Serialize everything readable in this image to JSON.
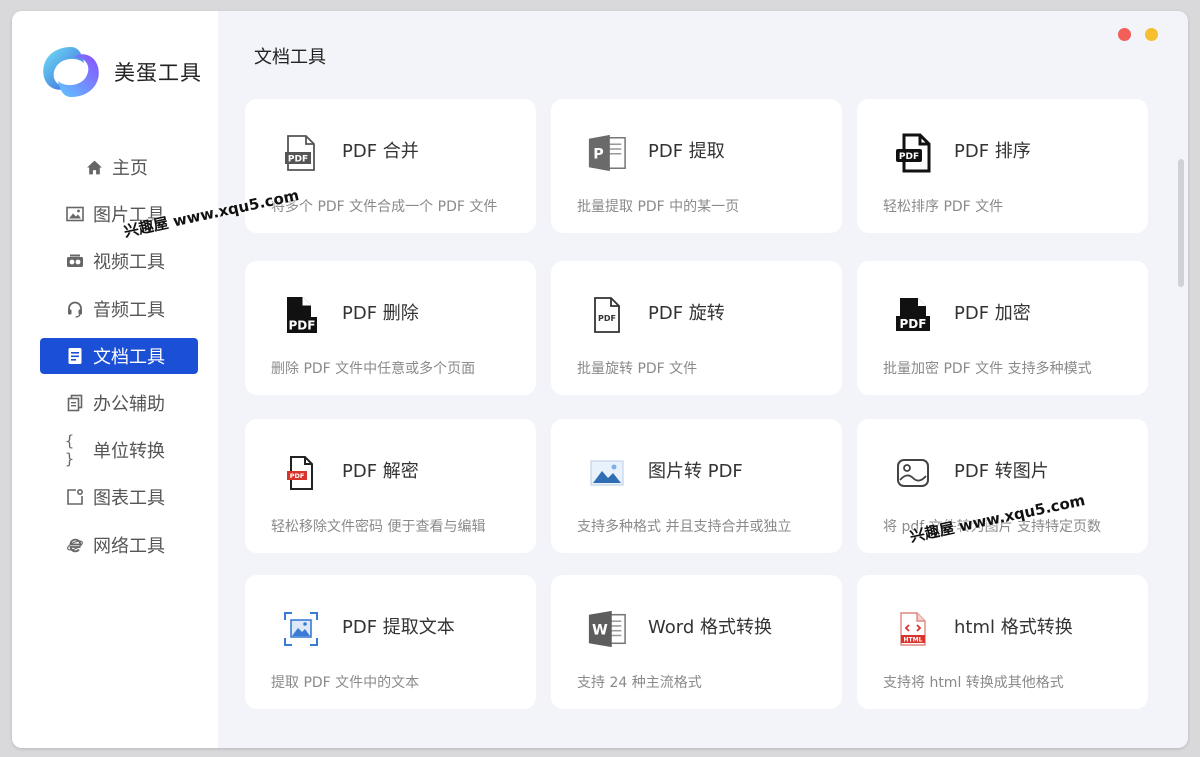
{
  "app": {
    "title": "美蛋工具"
  },
  "colors": {
    "accent": "#1b4fd6",
    "close": "#f25f58",
    "minimize": "#f6bf30",
    "pdf_red": "#d9342b"
  },
  "sidebar": {
    "items": [
      {
        "label": "主页",
        "icon": "home-icon",
        "active": false
      },
      {
        "label": "图片工具",
        "icon": "image-icon",
        "active": false
      },
      {
        "label": "视频工具",
        "icon": "video-icon",
        "active": false
      },
      {
        "label": "音频工具",
        "icon": "headset-icon",
        "active": false
      },
      {
        "label": "文档工具",
        "icon": "document-icon",
        "active": true
      },
      {
        "label": "办公辅助",
        "icon": "copy-icon",
        "active": false
      },
      {
        "label": "单位转换",
        "icon": "braces-icon",
        "active": false
      },
      {
        "label": "图表工具",
        "icon": "chart-icon",
        "active": false
      },
      {
        "label": "网络工具",
        "icon": "browser-e-icon",
        "active": false
      }
    ]
  },
  "main": {
    "section_title": "文档工具",
    "cards": [
      {
        "title": "PDF 合并",
        "desc": "将多个 PDF 文件合成一个 PDF 文件",
        "icon": "pdf-merge-icon",
        "icon_text": "PDF"
      },
      {
        "title": "PDF 提取",
        "desc": "批量提取 PDF 中的某一页",
        "icon": "pdf-extract-icon",
        "icon_text": "P"
      },
      {
        "title": "PDF 排序",
        "desc": "轻松排序 PDF 文件",
        "icon": "pdf-sort-icon",
        "icon_text": "PDF"
      },
      {
        "title": "PDF 删除",
        "desc": "删除 PDF 文件中任意或多个页面",
        "icon": "pdf-delete-icon",
        "icon_text": "PDF"
      },
      {
        "title": "PDF 旋转",
        "desc": "批量旋转 PDF 文件",
        "icon": "pdf-rotate-icon",
        "icon_text": "PDF"
      },
      {
        "title": "PDF 加密",
        "desc": "批量加密 PDF 文件 支持多种模式",
        "icon": "pdf-encrypt-icon",
        "icon_text": "PDF"
      },
      {
        "title": "PDF 解密",
        "desc": "轻松移除文件密码 便于查看与编辑",
        "icon": "pdf-decrypt-icon",
        "icon_text": "PDF"
      },
      {
        "title": "图片转 PDF",
        "desc": "支持多种格式 并且支持合并或独立",
        "icon": "image-to-pdf-icon",
        "icon_text": ""
      },
      {
        "title": "PDF 转图片",
        "desc": "将 pdf 文件转为图片 支持特定页数",
        "icon": "pdf-to-image-icon",
        "icon_text": ""
      },
      {
        "title": "PDF 提取文本",
        "desc": "提取 PDF 文件中的文本",
        "icon": "pdf-extract-text-icon",
        "icon_text": ""
      },
      {
        "title": "Word 格式转换",
        "desc": "支持 24 种主流格式",
        "icon": "word-icon",
        "icon_text": "W"
      },
      {
        "title": "html 格式转换",
        "desc": "支持将 html 转换成其他格式",
        "icon": "html-icon",
        "icon_text": "HTML"
      }
    ]
  },
  "watermarks": [
    "兴趣屋 www.xqu5.com",
    "兴趣屋 www.xqu5.com"
  ]
}
